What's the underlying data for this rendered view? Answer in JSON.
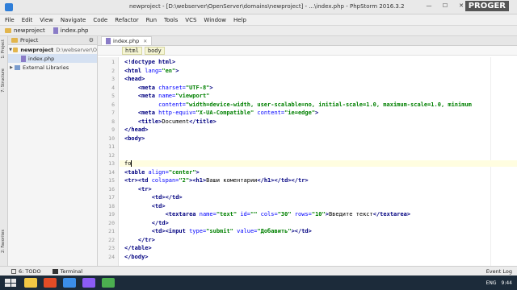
{
  "window": {
    "title": "newproject - [D:\\webserver\\OpenServer\\domains\\newproject] - ...\\index.php - PhpStorm 2016.3.2",
    "brand": "PROGER",
    "minimize": "—",
    "maximize": "☐",
    "close": "✕"
  },
  "menu": [
    "File",
    "Edit",
    "View",
    "Navigate",
    "Code",
    "Refactor",
    "Run",
    "Tools",
    "VCS",
    "Window",
    "Help"
  ],
  "nav": {
    "project": "newproject",
    "file": "index.php"
  },
  "left_tabs": {
    "project": "1: Project",
    "structure": "7: Structure",
    "favorites": "2: Favorites"
  },
  "project_panel": {
    "header": "Project",
    "root_name": "newproject",
    "root_path": "D:\\webserver\\O",
    "file": "index.php",
    "external": "External Libraries"
  },
  "editor": {
    "tab": "index.php",
    "breadcrumbs": [
      "html",
      "body"
    ],
    "line_numbers": [
      "1",
      "2",
      "3",
      "4",
      "5",
      "6",
      "7",
      "8",
      "9",
      "10",
      "11",
      "12",
      "13",
      "14",
      "15",
      "16",
      "17",
      "18",
      "19",
      "20",
      "21",
      "22",
      "23",
      "24"
    ]
  },
  "bottom": {
    "todo": "6: TODO",
    "terminal": "Terminal",
    "event_log": "Event Log"
  },
  "tray": {
    "lang": "ENG",
    "time": "9:44"
  },
  "colors": {
    "tag": "#000080",
    "attribute": "#0000ff",
    "string": "#008000",
    "current_line": "#fffde0"
  }
}
